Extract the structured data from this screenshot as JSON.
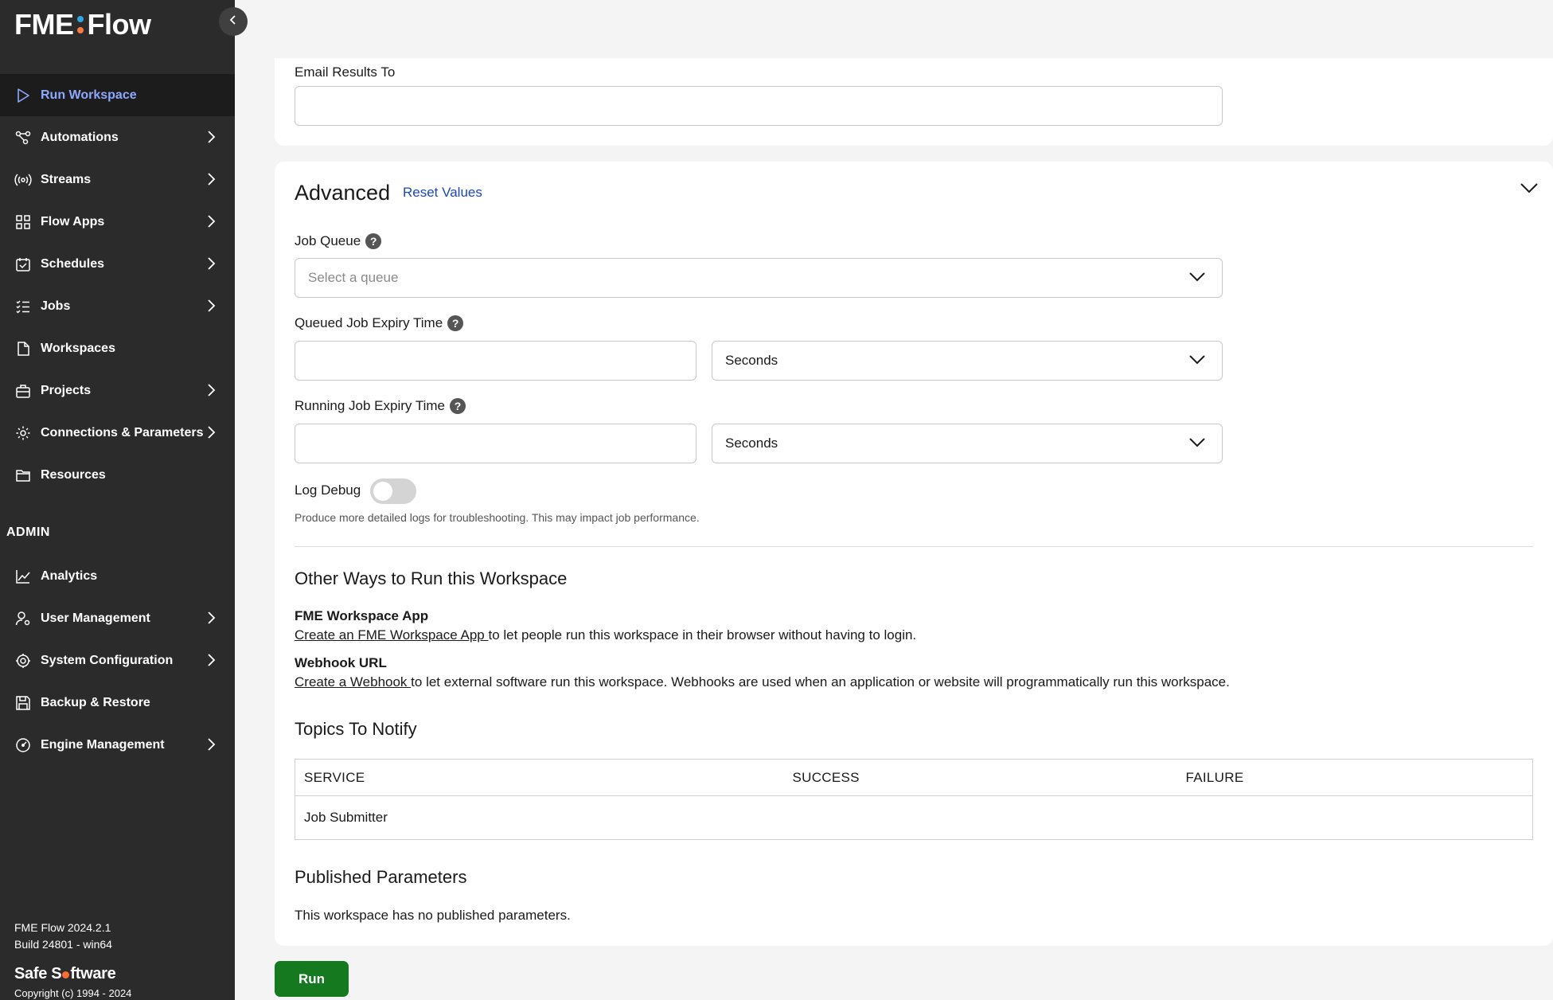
{
  "app": {
    "brand": "FME",
    "brand_product": "Flow",
    "version": "FME Flow 2024.2.1",
    "build": "Build 24801 - win64",
    "company_left": "Safe S",
    "company_right": "ftware",
    "copyright": "Copyright (c) 1994 - 2024"
  },
  "sidebar": {
    "items": [
      {
        "label": "Run Workspace",
        "icon": "play-icon",
        "active": true
      },
      {
        "label": "Automations",
        "icon": "automation-icon"
      },
      {
        "label": "Streams",
        "icon": "stream-icon"
      },
      {
        "label": "Flow Apps",
        "icon": "apps-icon"
      },
      {
        "label": "Schedules",
        "icon": "calendar-icon"
      },
      {
        "label": "Jobs",
        "icon": "jobs-list-icon"
      },
      {
        "label": "Workspaces",
        "icon": "file-icon"
      },
      {
        "label": "Projects",
        "icon": "briefcase-icon"
      },
      {
        "label": "Connections & Parameters",
        "icon": "gear-key-icon"
      },
      {
        "label": "Resources",
        "icon": "folder-icon"
      }
    ],
    "admin_label": "ADMIN",
    "admin_items": [
      {
        "label": "Analytics",
        "icon": "chart-line-icon"
      },
      {
        "label": "User Management",
        "icon": "user-gear-icon"
      },
      {
        "label": "System Configuration",
        "icon": "gear-icon"
      },
      {
        "label": "Backup & Restore",
        "icon": "save-icon"
      },
      {
        "label": "Engine Management",
        "icon": "gauge-icon"
      }
    ]
  },
  "email": {
    "label": "Email Results To",
    "value": ""
  },
  "advanced": {
    "title": "Advanced",
    "reset_label": "Reset Values",
    "job_queue_label": "Job Queue",
    "job_queue_placeholder": "Select a queue",
    "queued_expiry_label": "Queued Job Expiry Time",
    "queued_expiry_value": "",
    "queued_expiry_unit": "Seconds",
    "running_expiry_label": "Running Job Expiry Time",
    "running_expiry_value": "",
    "running_expiry_unit": "Seconds",
    "log_debug_label": "Log Debug",
    "log_debug_on": false,
    "log_debug_hint": "Produce more detailed logs for troubleshooting. This may impact job performance."
  },
  "other_ways": {
    "title": "Other Ways to Run this Workspace",
    "app_title": "FME Workspace App",
    "app_link": "Create an FME Workspace App ",
    "app_text": "to let people run this workspace in their browser without having to login.",
    "webhook_title": "Webhook URL",
    "webhook_link": "Create a Webhook ",
    "webhook_text": "to let external software run this workspace. Webhooks are used when an application or website will programmatically run this workspace."
  },
  "topics": {
    "title": "Topics To Notify",
    "columns": [
      "SERVICE",
      "SUCCESS",
      "FAILURE"
    ],
    "rows": [
      {
        "service": "Job Submitter",
        "success": "",
        "failure": ""
      }
    ]
  },
  "published": {
    "title": "Published Parameters",
    "text": "This workspace has no published parameters."
  },
  "actions": {
    "run_label": "Run"
  },
  "colors": {
    "sidebar_bg": "#2b2b2b",
    "active_text": "#8ea8ff",
    "link": "#1a47c2",
    "run_button": "#157a1f",
    "logo_dot_orange": "#ff7a3d",
    "logo_dot_blue": "#2fa8e0"
  }
}
